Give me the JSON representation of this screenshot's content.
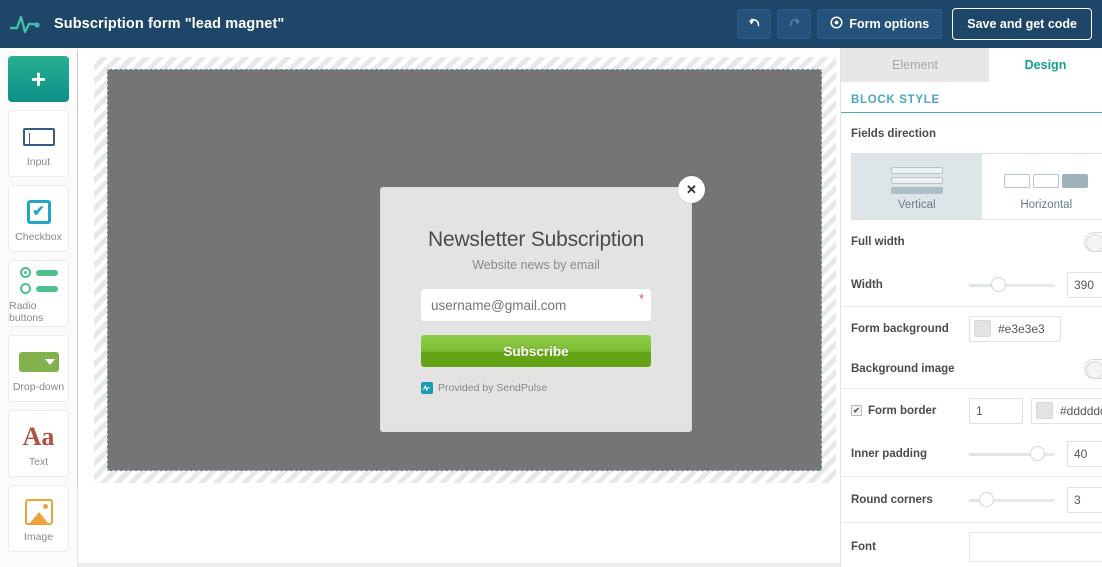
{
  "topbar": {
    "logo_icon": "sendpulse-pulse-logo",
    "title": "Subscription form \"lead magnet\"",
    "undo_icon": "undo-arrow-icon",
    "redo_icon": "redo-arrow-icon",
    "form_options_label": "Form options",
    "form_options_icon": "gear-icon",
    "save_label": "Save and get code",
    "background_color": "#1d4668"
  },
  "sidebar": {
    "add_label": "+",
    "items": [
      {
        "label": "Input",
        "icon": "text-input-icon"
      },
      {
        "label": "Checkbox",
        "icon": "checkbox-icon"
      },
      {
        "label": "Radio buttons",
        "icon": "radio-buttons-icon"
      },
      {
        "label": "Drop-down",
        "icon": "dropdown-icon"
      },
      {
        "label": "Text",
        "icon": "text-aa-icon"
      },
      {
        "label": "Image",
        "icon": "image-picture-icon"
      }
    ]
  },
  "form_preview": {
    "close_icon": "close-x-icon",
    "title": "Newsletter Subscription",
    "subtitle": "Website news by email",
    "email_placeholder": "username@gmail.com",
    "email_value": "",
    "required_marker": "*",
    "submit_label": "Subscribe",
    "footer_icon": "sendpulse-badge-icon",
    "footer_text": "Provided by SendPulse",
    "form_background": "#e3e3e3",
    "button_color": "#7cbd33"
  },
  "right_panel": {
    "tabs": [
      {
        "label": "Element",
        "active": false
      },
      {
        "label": "Design",
        "active": true
      }
    ],
    "section_title": "BLOCK STYLE",
    "section_accent": "#4aa8c0",
    "fields_direction": {
      "label": "Fields direction",
      "options": [
        {
          "label": "Vertical",
          "selected": true
        },
        {
          "label": "Horizontal",
          "selected": false
        }
      ]
    },
    "rows": {
      "full_width": {
        "label": "Full width",
        "toggle": "off"
      },
      "width": {
        "label": "Width",
        "value": "390",
        "slider_pct": 31
      },
      "form_background": {
        "label": "Form background",
        "value": "#e3e3e3",
        "swatch": "#e3e3e3"
      },
      "background_image": {
        "label": "Background image",
        "toggle": "off"
      },
      "form_border": {
        "label": "Form border",
        "checked": true,
        "checkmark": "✔",
        "width_value": "1",
        "color_value": "#dddddd",
        "swatch": "#e3e3e3"
      },
      "inner_padding": {
        "label": "Inner padding",
        "value": "40",
        "slider_pct": 86
      },
      "round_corners": {
        "label": "Round corners",
        "value": "3",
        "slider_pct": 14
      },
      "font": {
        "label": "Font",
        "value": "",
        "placeholder": ""
      }
    }
  }
}
